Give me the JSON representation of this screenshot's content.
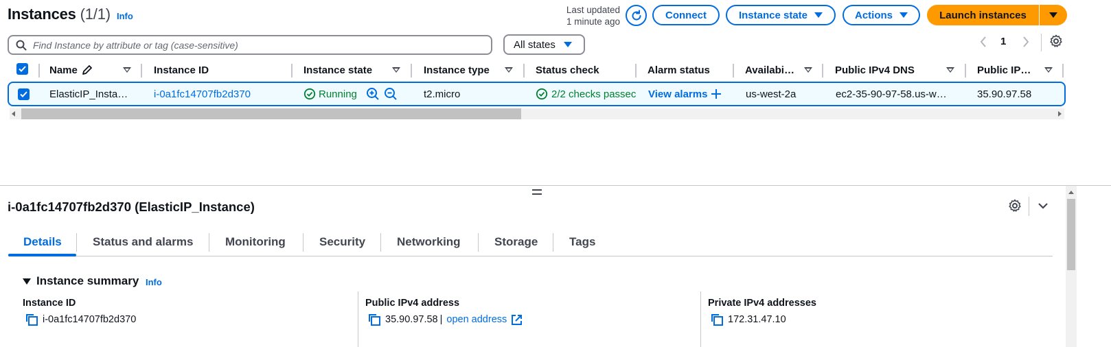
{
  "header": {
    "title": "Instances",
    "count": "(1/1)",
    "info": "Info",
    "last_updated_line1": "Last updated",
    "last_updated_line2": "1 minute ago",
    "connect_label": "Connect",
    "instance_state_label": "Instance state",
    "actions_label": "Actions",
    "launch_label": "Launch instances"
  },
  "filter": {
    "search_placeholder": "Find Instance by attribute or tag (case-sensitive)",
    "states_label": "All states",
    "page_number": "1"
  },
  "table": {
    "columns": [
      "Name",
      "Instance ID",
      "Instance state",
      "Instance type",
      "Status check",
      "Alarm status",
      "Availabi…",
      "Public IPv4 DNS",
      "Public IP…"
    ],
    "rows": [
      {
        "name": "ElasticIP_Insta…",
        "instance_id": "i-0a1fc14707fb2d370",
        "state": "Running",
        "type": "t2.micro",
        "status_check": "2/2 checks passec",
        "alarm": "View alarms",
        "az": "us-west-2a",
        "dns": "ec2-35-90-97-58.us-w…",
        "public_ip": "35.90.97.58"
      }
    ]
  },
  "details": {
    "title": "i-0a1fc14707fb2d370 (ElasticIP_Instance)",
    "tabs": [
      "Details",
      "Status and alarms",
      "Monitoring",
      "Security",
      "Networking",
      "Storage",
      "Tags"
    ],
    "summary_title": "Instance summary",
    "summary_info": "Info",
    "fields": [
      {
        "label": "Instance ID",
        "value": "i-0a1fc14707fb2d370"
      },
      {
        "label": "Public IPv4 address",
        "value": "35.90.97.58",
        "separator": "|",
        "link": "open address"
      },
      {
        "label": "Private IPv4 addresses",
        "value": "172.31.47.10"
      }
    ]
  },
  "colors": {
    "accent": "#006ce0",
    "launch": "#ff9900",
    "success": "#00802f",
    "row_selected": "#f0fbff"
  }
}
